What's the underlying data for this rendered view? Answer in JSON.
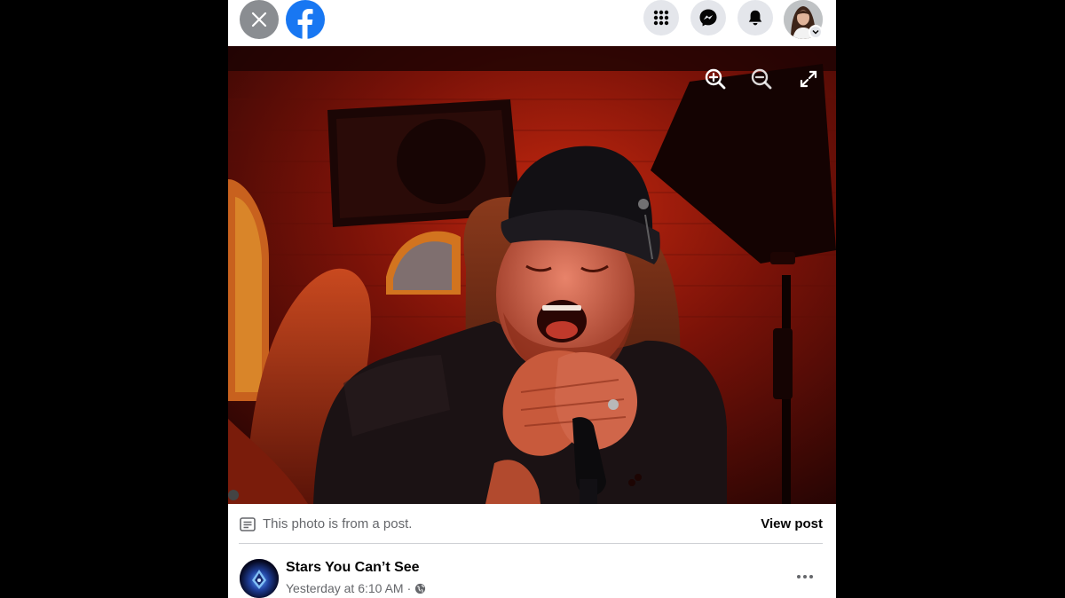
{
  "colors": {
    "brand": "#1877f2",
    "page_bg": "#000000",
    "secondary_text": "#65676b",
    "primary_text": "#050505",
    "button_bg": "#e4e6eb"
  },
  "topbar": {
    "close_icon": "close-icon",
    "logo_icon": "facebook-logo-icon",
    "menu_icon": "grid-menu-icon",
    "messenger_icon": "messenger-icon",
    "notifications_icon": "bell-icon",
    "account_caret_icon": "chevron-down-icon"
  },
  "photo": {
    "controls": [
      "zoom-in-icon",
      "zoom-out-icon",
      "fullscreen-icon"
    ]
  },
  "post_info": {
    "from_post_text": "This photo is from a post.",
    "view_post_label": "View post",
    "page_name": "Stars You Can’t See",
    "timestamp": "Yesterday at 6:10 AM",
    "separator": "·",
    "audience_icon": "globe-icon",
    "more_icon": "more-horizontal-icon"
  }
}
